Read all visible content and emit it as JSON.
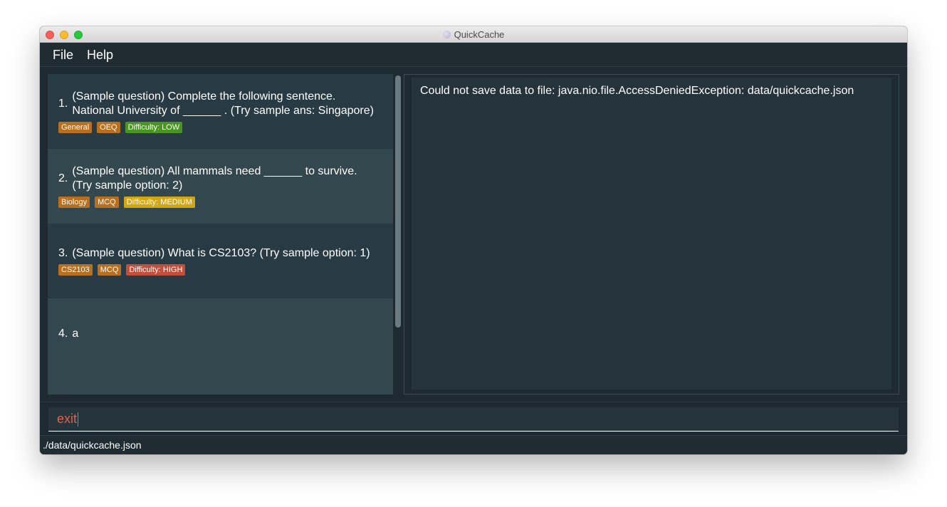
{
  "window": {
    "title": "QuickCache"
  },
  "menu": {
    "file": "File",
    "help": "Help"
  },
  "questions": [
    {
      "index": "1.",
      "text": "(Sample question) Complete the following sentence. National University of ______ . (Try sample ans: Singapore)",
      "tags": [
        {
          "label": "General",
          "color": "#b8701e"
        },
        {
          "label": "OEQ",
          "color": "#b8701e"
        },
        {
          "label": "Difficulty: LOW",
          "color": "#48951f"
        }
      ]
    },
    {
      "index": "2.",
      "text": "(Sample question) All mammals need ______ to survive. (Try sample option: 2)",
      "tags": [
        {
          "label": "Biology",
          "color": "#b8701e"
        },
        {
          "label": "MCQ",
          "color": "#b8701e"
        },
        {
          "label": "Difficulty: MEDIUM",
          "color": "#d3a713"
        }
      ]
    },
    {
      "index": "3.",
      "text": "(Sample question) What is CS2103? (Try sample option: 1)",
      "tags": [
        {
          "label": "CS2103",
          "color": "#b8701e"
        },
        {
          "label": "MCQ",
          "color": "#b8701e"
        },
        {
          "label": "Difficulty: HIGH",
          "color": "#c34f3a"
        }
      ]
    },
    {
      "index": "4.",
      "text": "a",
      "tags": []
    }
  ],
  "result": {
    "message": "Could not save data to file: java.nio.file.AccessDeniedException: data/quickcache.json"
  },
  "command": {
    "value": "exit"
  },
  "status": {
    "path": "./data/quickcache.json"
  }
}
